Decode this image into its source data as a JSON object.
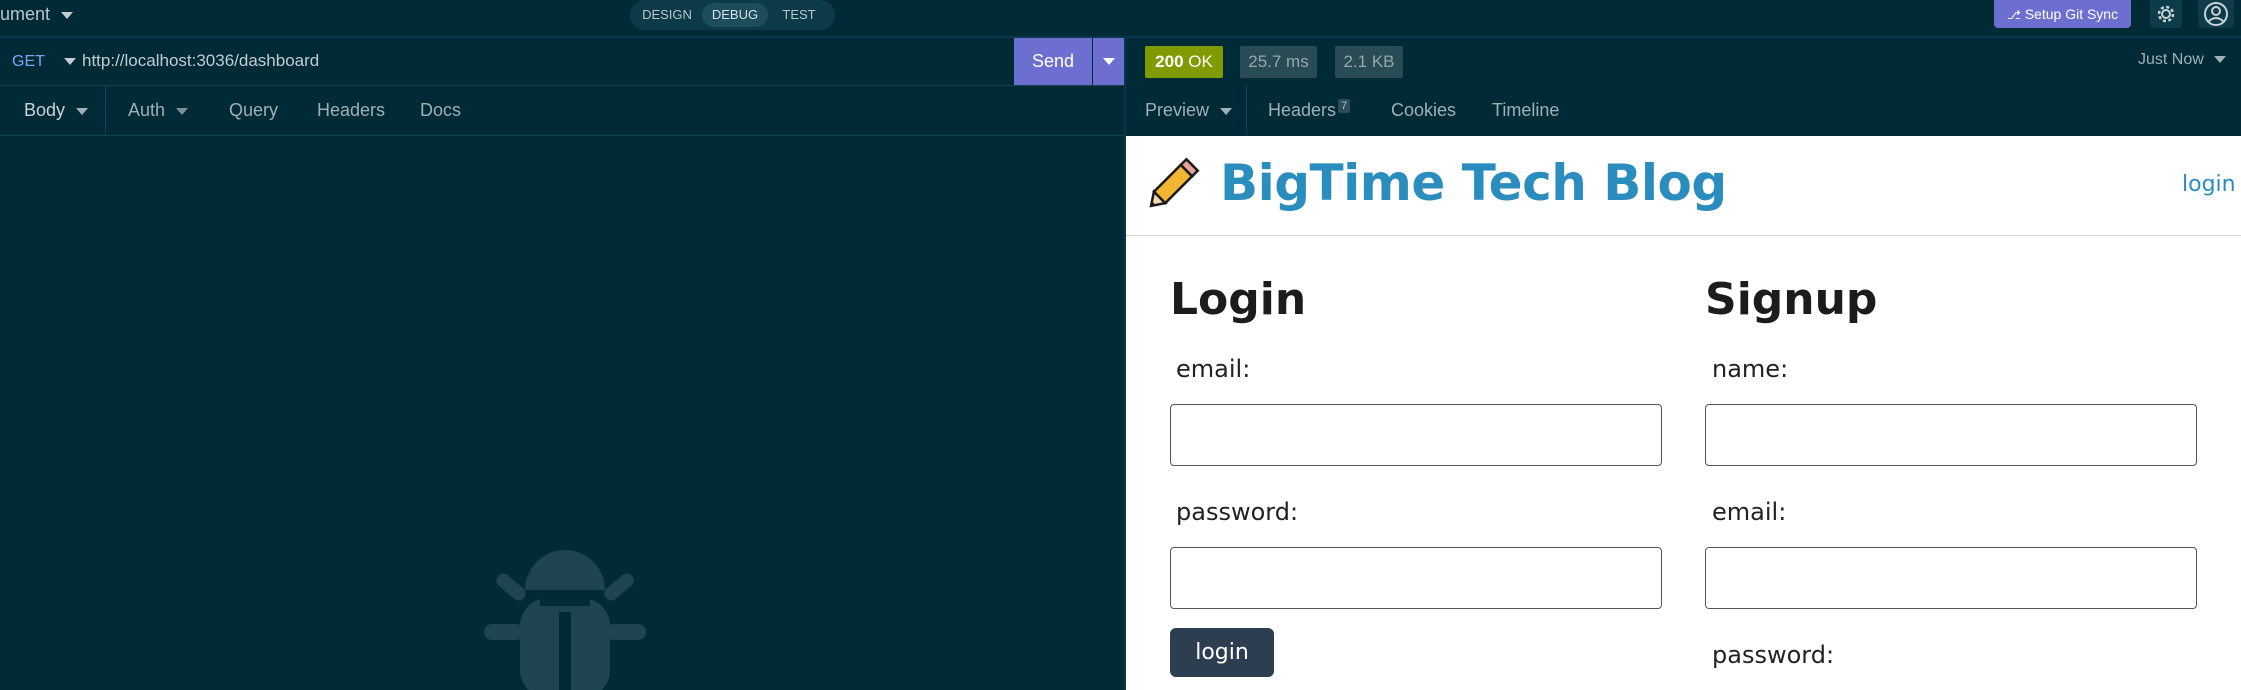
{
  "app": {
    "document_name": "ument",
    "modes": [
      "DESIGN",
      "DEBUG",
      "TEST"
    ],
    "active_mode": "DEBUG",
    "git_sync_label": "Setup Git Sync"
  },
  "request": {
    "method": "GET",
    "url": "http://localhost:3036/dashboard",
    "send_label": "Send",
    "tabs": {
      "body": "Body",
      "auth": "Auth",
      "query": "Query",
      "headers": "Headers",
      "docs": "Docs"
    }
  },
  "response": {
    "status_code": "200",
    "status_text": "OK",
    "time": "25.7 ms",
    "size": "2.1 KB",
    "timestamp": "Just Now",
    "tabs": {
      "preview": "Preview",
      "headers": "Headers",
      "headers_count": "7",
      "cookies": "Cookies",
      "timeline": "Timeline"
    }
  },
  "preview_page": {
    "site_title": "BigTime Tech Blog",
    "nav_login": "login",
    "login_form": {
      "heading": "Login",
      "email_label": "email:",
      "password_label": "password:",
      "submit_label": "login"
    },
    "signup_form": {
      "heading": "Signup",
      "name_label": "name:",
      "email_label": "email:",
      "password_label": "password:"
    }
  },
  "colors": {
    "background": "#002b36",
    "accent": "#6c6fd0",
    "status_ok": "#7f9b00",
    "blog_link": "#2a8dbd"
  }
}
